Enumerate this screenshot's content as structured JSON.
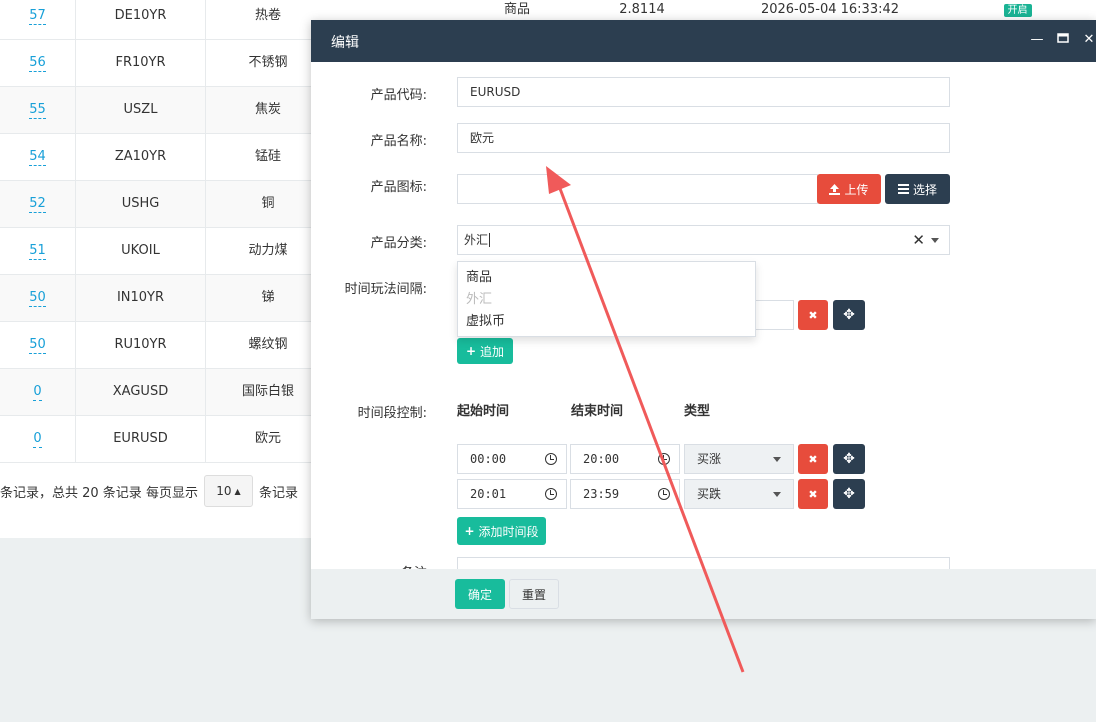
{
  "list": {
    "rows": [
      {
        "weigh": "57",
        "code": "DE10YR",
        "name": "热卷"
      },
      {
        "weigh": "56",
        "code": "FR10YR",
        "name": "不锈钢"
      },
      {
        "weigh": "55",
        "code": "USZL",
        "name": "焦炭"
      },
      {
        "weigh": "54",
        "code": "ZA10YR",
        "name": "锰硅"
      },
      {
        "weigh": "52",
        "code": "USHG",
        "name": "铜"
      },
      {
        "weigh": "51",
        "code": "UKOIL",
        "name": "动力煤"
      },
      {
        "weigh": "50",
        "code": "IN10YR",
        "name": "锑"
      },
      {
        "weigh": "50",
        "code": "RU10YR",
        "name": "螺纹钢"
      },
      {
        "weigh": "0",
        "code": "XAGUSD",
        "name": "国际白银"
      },
      {
        "weigh": "0",
        "code": "EURUSD",
        "name": "欧元"
      }
    ],
    "first_row_extra": {
      "category": "商品",
      "price": "2.8114",
      "time": "2026-05-04 16:33:42",
      "status": "开启"
    },
    "pagination": {
      "prefix": "条记录，总共 20 条记录 每页显示",
      "page_size": "10",
      "suffix": "条记录"
    }
  },
  "modal": {
    "title": "编辑",
    "fields": {
      "code_label": "产品代码:",
      "code_value": "EURUSD",
      "name_label": "产品名称:",
      "name_value": "欧元",
      "icon_label": "产品图标:",
      "icon_value": "",
      "upload_label": "上传",
      "choose_label": "选择",
      "category_label": "产品分类:",
      "category_value": "外汇",
      "category_options": [
        "商品",
        "外汇",
        "虚拟币"
      ],
      "interval_label": "时间玩法间隔:",
      "add_label": "追加",
      "period_label": "时间段控制:",
      "col_start": "起始时间",
      "col_end": "结束时间",
      "col_type": "类型",
      "periods": [
        {
          "start": "00:00",
          "end": "20:00",
          "type": "买涨"
        },
        {
          "start": "20:01",
          "end": "23:59",
          "type": "买跌"
        }
      ],
      "add_period_label": "添加时间段",
      "remark_label": "备注"
    },
    "footer": {
      "confirm_label": "确定",
      "reset_label": "重置"
    }
  },
  "colors": {
    "header": "#2c3e50",
    "danger": "#e74c3c",
    "success": "#18bc9c",
    "link": "#18a0d8",
    "arrow": "#f05a5a"
  }
}
